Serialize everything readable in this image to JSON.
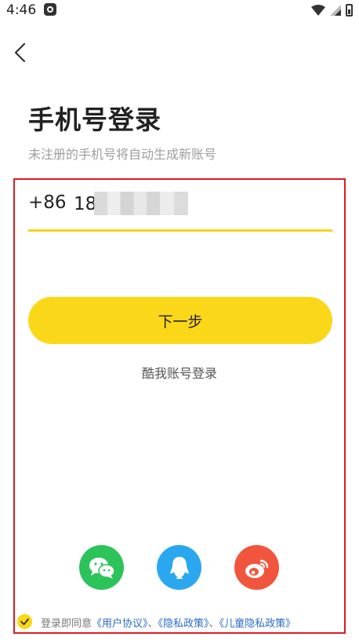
{
  "status_bar": {
    "time": "4:46"
  },
  "header": {
    "title": "手机号登录",
    "subtitle": "未注册的手机号将自动生成新账号"
  },
  "phone": {
    "country_code": "+86",
    "value": "18"
  },
  "next_button": {
    "label": "下一步"
  },
  "alt_login": {
    "label": "酷我账号登录"
  },
  "social": {
    "wechat": "wechat-icon",
    "qq": "qq-icon",
    "weibo": "weibo-icon",
    "colors": {
      "wechat": "#2dc35b",
      "qq": "#2aa7ef",
      "weibo": "#f2553d"
    }
  },
  "agreement": {
    "prefix": "登录即同意",
    "user_agreement": "《用户协议》",
    "sep1": "、",
    "privacy_policy": "《隐私政策》",
    "sep2": "、",
    "child_privacy": "《儿童隐私政策》"
  },
  "colors": {
    "accent": "#fbd71a",
    "link": "#2b6cc4",
    "highlight_border": "#e01b22"
  }
}
